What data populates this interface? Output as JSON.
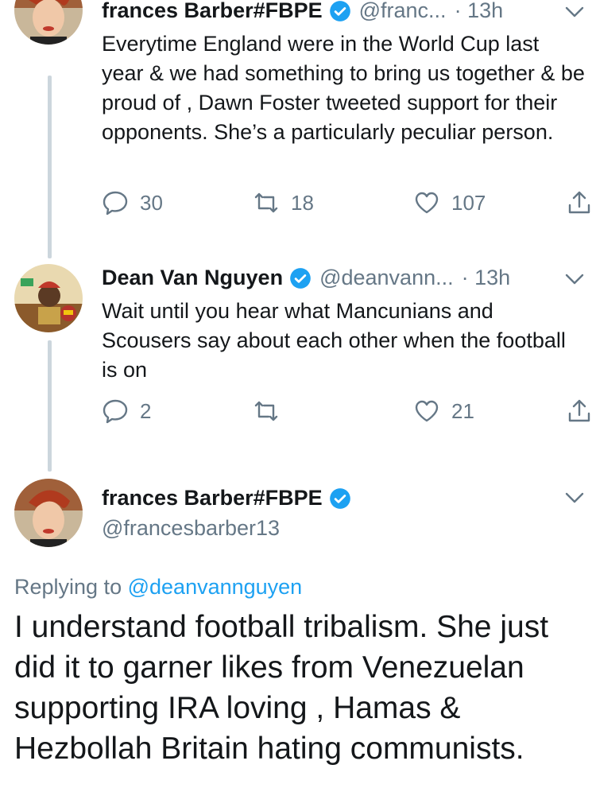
{
  "tweets": [
    {
      "name": "frances Barber#FBPE",
      "handle": "@franc...",
      "time": "· 13h",
      "text": "Everytime England were in the World Cup last year & we had something to bring us together & be proud of , Dawn Foster tweeted support for their opponents. She’s a particularly peculiar person.",
      "replies": "30",
      "retweets": "18",
      "likes": "107"
    },
    {
      "name": "Dean Van Nguyen",
      "handle": "@deanvann...",
      "time": "· 13h",
      "text": "Wait until you hear what Mancunians and Scousers say about each other when the football is on",
      "replies": "2",
      "retweets": "",
      "likes": "21"
    }
  ],
  "main": {
    "name": "frances Barber#FBPE",
    "handle": "@francesbarber13",
    "replying_prefix": "Replying to",
    "replying_to": "@deanvannguyen",
    "text": "I understand football tribalism. She just did it to garner likes from Venezuelan supporting IRA loving , Hamas & Hezbollah Britain hating communists."
  },
  "colors": {
    "accent": "#1da1f2",
    "muted": "#657786",
    "verified": "#1da1f2",
    "line": "#ccd6dd"
  }
}
